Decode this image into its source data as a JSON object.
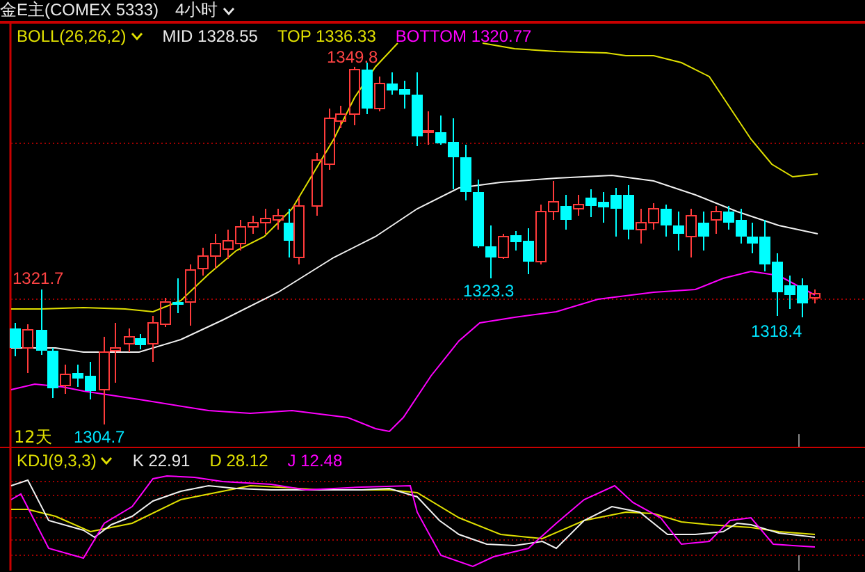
{
  "header": {
    "symbol": "金E主(COMEX 5333)",
    "period": "4小时"
  },
  "boll": {
    "name": "BOLL(26,26,2)",
    "mid": "MID 1328.55",
    "top": "TOP 1336.33",
    "bottom": "BOTTOM 1320.77"
  },
  "price_labels": [
    {
      "text": "1349.8",
      "kind": "high"
    },
    {
      "text": "1321.7",
      "kind": "high"
    },
    {
      "text": "1323.3",
      "kind": "low"
    },
    {
      "text": "1318.4",
      "kind": "low"
    },
    {
      "text": "1304.7",
      "kind": "low"
    }
  ],
  "range_label": "12天",
  "kdj": {
    "name": "KDJ(9,3,3)",
    "k": "K 22.91",
    "d": "D 28.12",
    "j": "J 12.48"
  }
}
